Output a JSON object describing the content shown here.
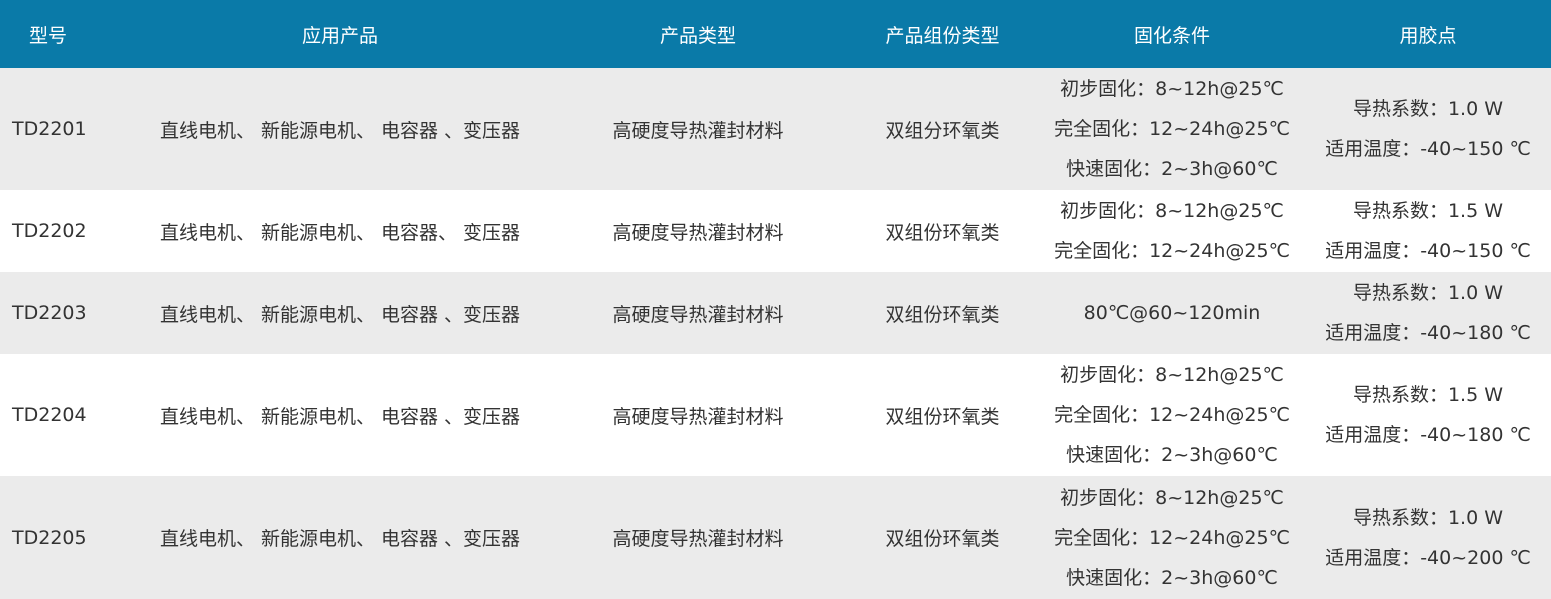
{
  "headers": {
    "model": "型号",
    "application": "应用产品",
    "product_type": "产品类型",
    "component_type": "产品组份类型",
    "curing": "固化条件",
    "glue_point": "用胶点"
  },
  "rows": [
    {
      "model": "TD2201",
      "application": "直线电机、 新能源电机、 电容器 、变压器",
      "product_type": "高硬度导热灌封材料",
      "component_type": "双组分环氧类",
      "curing": [
        "初步固化：8~12h@25℃",
        "完全固化：12~24h@25℃",
        "快速固化：2~3h@60℃"
      ],
      "glue_point": [
        "导热系数：1.0 W",
        "适用温度：-40~150 ℃"
      ]
    },
    {
      "model": "TD2202",
      "application": "直线电机、 新能源电机、 电容器、 变压器",
      "product_type": "高硬度导热灌封材料",
      "component_type": "双组份环氧类",
      "curing": [
        "初步固化：8~12h@25℃",
        "完全固化：12~24h@25℃",
        ""
      ],
      "glue_point": [
        "导热系数：1.5 W",
        "适用温度：-40~150 ℃"
      ]
    },
    {
      "model": "TD2203",
      "application": "直线电机、 新能源电机、 电容器 、变压器",
      "product_type": "高硬度导热灌封材料",
      "component_type": "双组份环氧类",
      "curing": [
        "80℃@60~120min",
        "",
        ""
      ],
      "glue_point": [
        "导热系数：1.0 W",
        "适用温度：-40~180 ℃"
      ]
    },
    {
      "model": "TD2204",
      "application": "直线电机、 新能源电机、 电容器 、变压器",
      "product_type": "高硬度导热灌封材料",
      "component_type": "双组份环氧类",
      "curing": [
        "初步固化：8~12h@25℃",
        "完全固化：12~24h@25℃",
        "快速固化：2~3h@60℃"
      ],
      "glue_point": [
        "导热系数：1.5 W",
        "适用温度：-40~180 ℃"
      ]
    },
    {
      "model": "TD2205",
      "application": "直线电机、 新能源电机、 电容器 、变压器",
      "product_type": "高硬度导热灌封材料",
      "component_type": "双组份环氧类",
      "curing": [
        "初步固化：8~12h@25℃",
        "完全固化：12~24h@25℃",
        "快速固化：2~3h@60℃"
      ],
      "glue_point": [
        "导热系数：1.0 W",
        "适用温度：-40~200 ℃"
      ]
    }
  ]
}
